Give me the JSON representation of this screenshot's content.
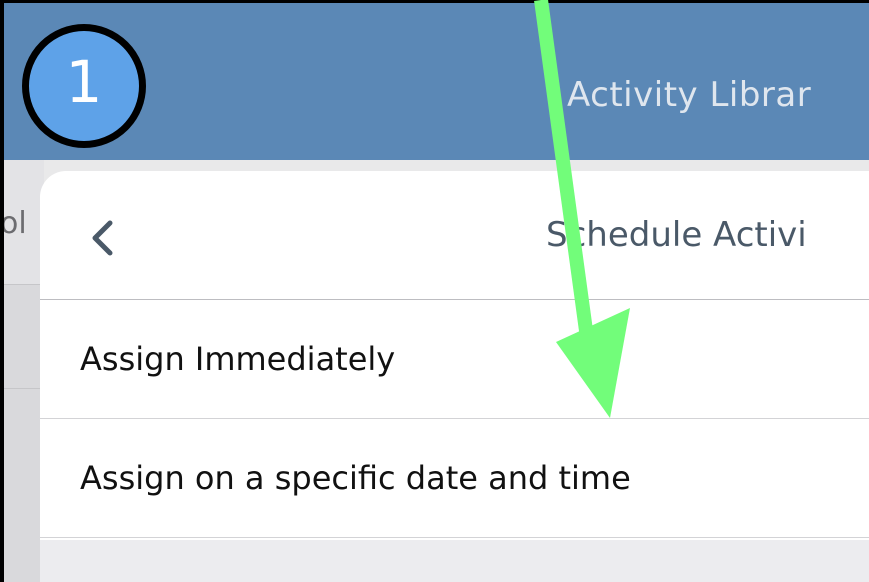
{
  "app_bar": {
    "title": "Activity Librar"
  },
  "background_page": {
    "fragment": "ol"
  },
  "sheet": {
    "title": "Schedule Activi",
    "back_icon": "chevron-left-icon",
    "options": [
      {
        "label": "Assign Immediately"
      },
      {
        "label": "Assign on a specific date and time"
      }
    ]
  },
  "annotation": {
    "step_number": "1",
    "badge_color": "#5ea2e8",
    "arrow_color": "#72fd7a"
  },
  "colors": {
    "app_bar": "#5b88b6",
    "sheet_background": "#ffffff",
    "title_text": "#4a5968"
  }
}
